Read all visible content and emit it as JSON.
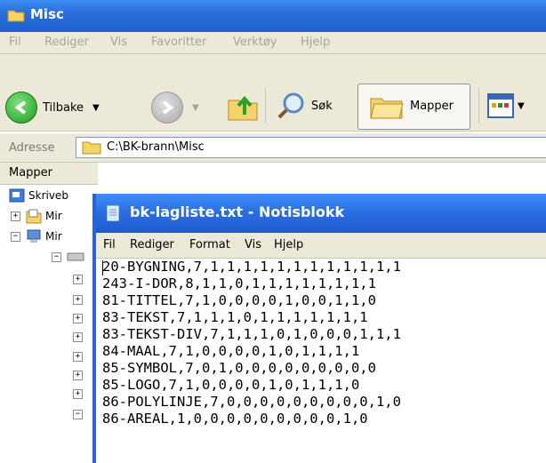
{
  "explorer": {
    "title": "Misc",
    "menu": [
      "Fil",
      "Rediger",
      "Vis",
      "Favoritter",
      "Verktøy",
      "Hjelp"
    ],
    "toolbar": {
      "back": "Tilbake",
      "search": "Søk",
      "folders": "Mapper"
    },
    "address": {
      "label": "Adresse",
      "path": "C:\\BK-brann\\Misc"
    },
    "folders_pane": {
      "header": "Mapper",
      "items": [
        "Skriveb",
        "Mir",
        "Mir"
      ]
    }
  },
  "notepad": {
    "title": "bk-lagliste.txt - Notisblokk",
    "menu": [
      "Fil",
      "Rediger",
      "Format",
      "Vis",
      "Hjelp"
    ],
    "lines": [
      "20-BYGNING,7,1,1,1,1,1,1,1,1,1,1,1,1",
      "243-I-DOR,8,1,1,0,1,1,1,1,1,1,1,1",
      "81-TITTEL,7,1,0,0,0,0,1,0,0,1,1,0",
      "83-TEKST,7,1,1,1,0,1,1,1,1,1,1,1",
      "83-TEKST-DIV,7,1,1,1,0,1,0,0,0,1,1,1",
      "84-MAAL,7,1,0,0,0,0,1,0,1,1,1,1",
      "85-SYMBOL,7,0,1,0,0,0,0,0,0,0,0,0",
      "85-LOGO,7,1,0,0,0,0,1,0,1,1,1,0",
      "86-POLYLINJE,7,0,0,0,0,0,0,0,0,0,1,0",
      "86-AREAL,1,0,0,0,0,0,0,0,0,0,1,0"
    ]
  },
  "colors": {
    "title_blue": "#2a6fdc",
    "chrome": "#ece9d8"
  }
}
